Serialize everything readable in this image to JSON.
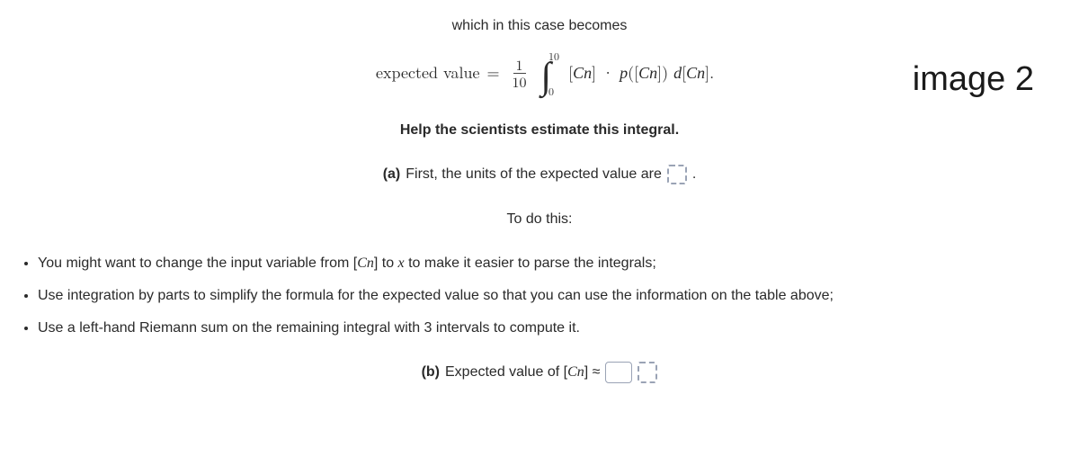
{
  "intro": "which in this case becomes",
  "formula": {
    "lhs": "expected value",
    "eq": "=",
    "frac_num": "1",
    "frac_den": "10",
    "int_lower": "0",
    "int_upper": "10",
    "integrand_a": "[",
    "integrand_cn1": "Cn",
    "integrand_b": "] · ",
    "integrand_p": "p",
    "integrand_c": "([",
    "integrand_cn2": "Cn",
    "integrand_d": "]) ",
    "integrand_dvar": "d",
    "integrand_e": "[",
    "integrand_cn3": "Cn",
    "integrand_f": "]."
  },
  "image_label": "image 2",
  "help_line": "Help the scientists estimate this integral.",
  "part_a": {
    "label": "(a)",
    "text_before": "First, the units of the expected value are",
    "text_after": "."
  },
  "todo_line": "To do this:",
  "bullets": [
    {
      "pre": "You might want to change the input variable from [",
      "cn": "Cn",
      "mid": "] to ",
      "x": "x",
      "post": " to make it easier to parse the integrals;"
    },
    {
      "full": "Use integration by parts to simplify the formula for the expected value so that you can use the information on the table above;"
    },
    {
      "full": "Use a left-hand Riemann sum on the remaining integral with 3 intervals to compute it."
    }
  ],
  "part_b": {
    "label": "(b)",
    "text_before": "Expected value of [",
    "cn": "Cn",
    "text_mid": "] ≈"
  }
}
